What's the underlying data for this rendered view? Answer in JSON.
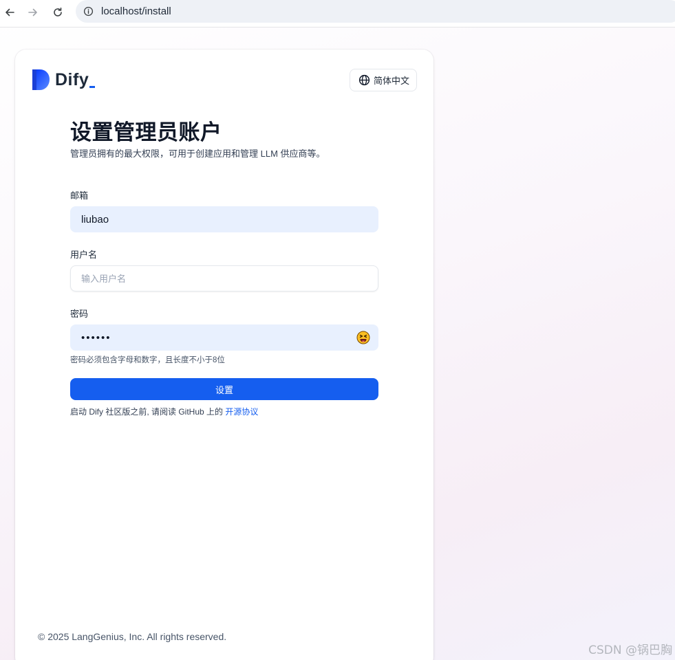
{
  "browser": {
    "url": "localhost/install"
  },
  "header": {
    "logo_text": "Dify",
    "language_label": "简体中文"
  },
  "form": {
    "title": "设置管理员账户",
    "subtitle": "管理员拥有的最大权限，可用于创建应用和管理 LLM 供应商等。",
    "email": {
      "label": "邮箱",
      "value": "liubao"
    },
    "username": {
      "label": "用户名",
      "placeholder": "输入用户名"
    },
    "password": {
      "label": "密码",
      "value": "123456",
      "hint": "密码必须包含字母和数字，且长度不小于8位"
    },
    "submit_label": "设置",
    "agreement_prefix": "启动 Dify 社区版之前, 请阅读 GitHub 上的 ",
    "agreement_link": "开源协议"
  },
  "footer": {
    "copyright": "© 2025 LangGenius, Inc. All rights reserved."
  },
  "watermark": "CSDN @锅巴胸",
  "colors": {
    "primary": "#155eef",
    "autofill": "#e8f0fe"
  }
}
